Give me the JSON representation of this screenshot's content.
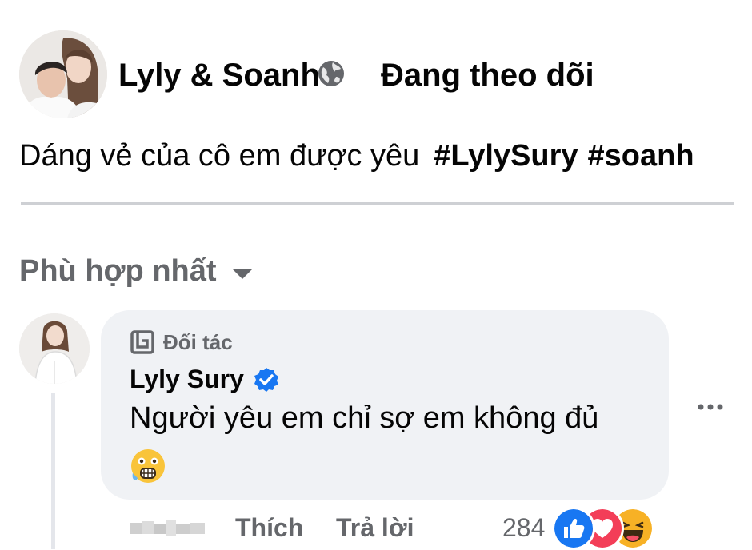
{
  "post": {
    "author": "Lyly & Soanh",
    "follow_status": "Đang theo dõi",
    "caption": "Dáng vẻ của cô em được yêu",
    "hashtags": [
      "#LylySury",
      "#soanh"
    ],
    "privacy_icon": "globe-icon"
  },
  "comments_section": {
    "sort_label": "Phù hợp nhất",
    "comment": {
      "badge_label": "Đối tác",
      "author": "Lyly Sury",
      "verified": true,
      "text": "Người yêu em chỉ sợ em không đủ",
      "emoji": "😲",
      "actions": {
        "like_label": "Thích",
        "reply_label": "Trả lời"
      },
      "reaction_count": "284",
      "reaction_types": [
        "like",
        "love",
        "haha"
      ]
    }
  },
  "colors": {
    "secondary_text": "#65676b",
    "bubble_bg": "#f0f2f5",
    "verified_blue": "#1877f2",
    "love_red": "#f33e58",
    "haha_yellow": "#f7b125"
  }
}
